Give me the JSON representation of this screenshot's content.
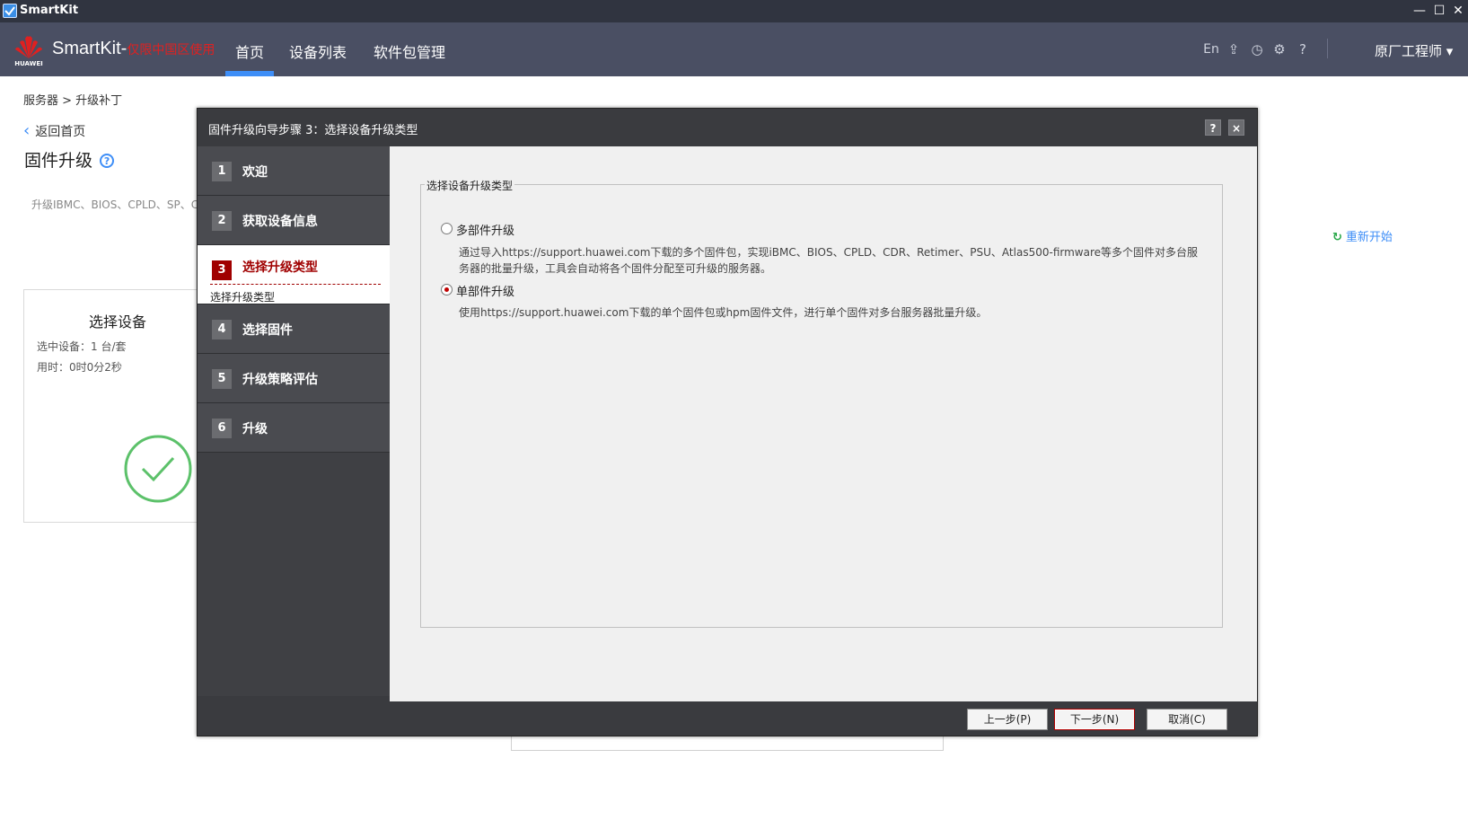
{
  "window": {
    "title": "SmartKit"
  },
  "nav": {
    "brand": "SmartKit-",
    "brand_restriction": "仅限中国区使用",
    "logo_text": "HUAWEI",
    "tabs": [
      "首页",
      "设备列表",
      "软件包管理"
    ],
    "lang": "En",
    "user": "原厂工程师"
  },
  "page": {
    "breadcrumb": "服务器 > 升级补丁",
    "back_label": "返回首页",
    "title": "固件升级",
    "desc": "升级IBMC、BIOS、CPLD、SP、C",
    "restart": "重新开始",
    "card": {
      "title": "选择设备",
      "selected": "选中设备：1 台/套",
      "elapsed": "用时：0时0分2秒"
    }
  },
  "dialog": {
    "title": "固件升级向导步骤 3：选择设备升级类型",
    "help": "?",
    "close": "×",
    "steps": [
      {
        "num": "1",
        "label": "欢迎"
      },
      {
        "num": "2",
        "label": "获取设备信息"
      },
      {
        "num": "3",
        "label": "选择升级类型",
        "sub": "选择升级类型"
      },
      {
        "num": "4",
        "label": "选择固件"
      },
      {
        "num": "5",
        "label": "升级策略评估"
      },
      {
        "num": "6",
        "label": "升级"
      }
    ],
    "group_title": "选择设备升级类型",
    "options": [
      {
        "label": "多部件升级",
        "checked": false,
        "desc": "通过导入https://support.huawei.com下载的多个固件包，实现iBMC、BIOS、CPLD、CDR、Retimer、PSU、Atlas500-firmware等多个固件对多台服务器的批量升级，工具会自动将各个固件分配至可升级的服务器。"
      },
      {
        "label": "单部件升级",
        "checked": true,
        "desc": "使用https://support.huawei.com下载的单个固件包或hpm固件文件，进行单个固件对多台服务器批量升级。"
      }
    ],
    "buttons": {
      "prev": "上一步(P)",
      "next": "下一步(N)",
      "cancel": "取消(C)"
    }
  },
  "colors": {
    "accent": "#3e8ef7",
    "active_step": "#a00000",
    "nav_bg": "#4a4f63"
  }
}
